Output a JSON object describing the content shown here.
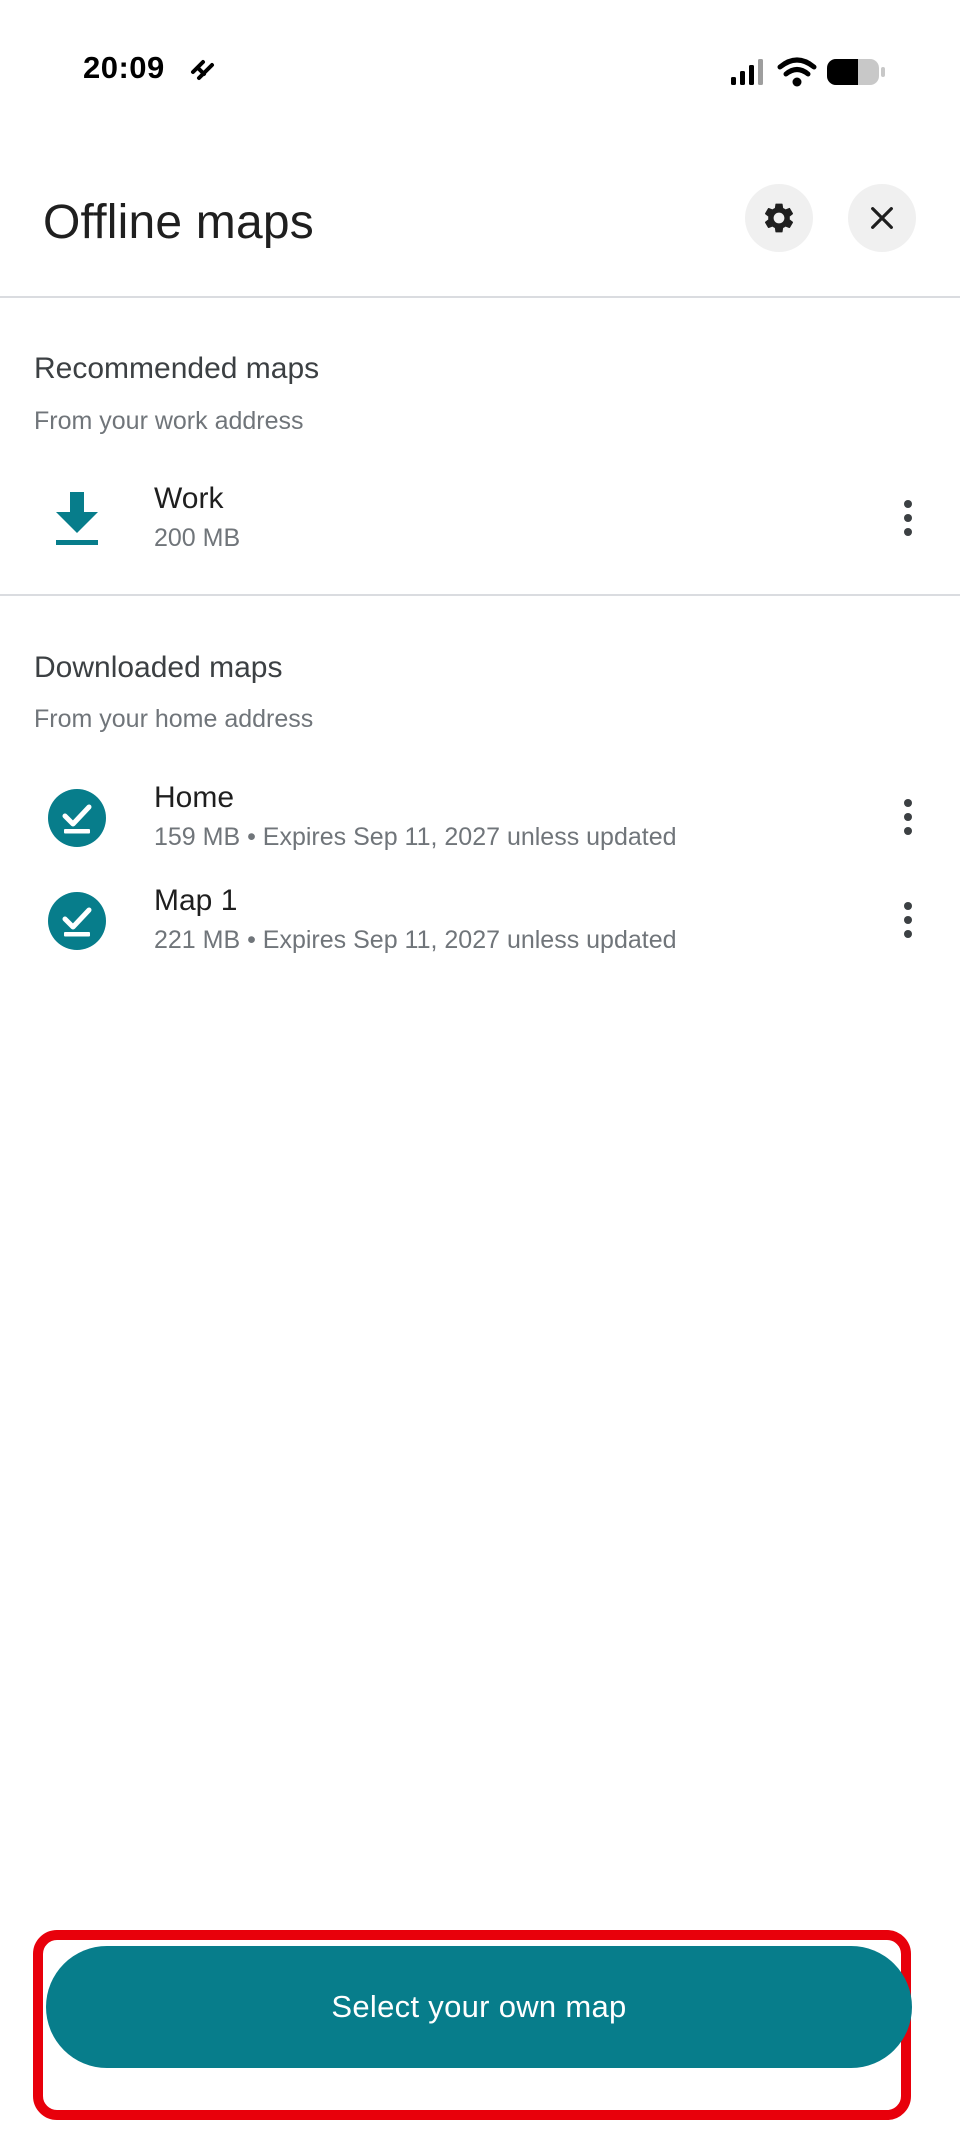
{
  "status_bar": {
    "time": "20:09",
    "icons": [
      "link-icon",
      "signal-icon",
      "wifi-icon",
      "battery-icon"
    ]
  },
  "header": {
    "title": "Offline maps",
    "settings_icon": "gear-icon",
    "close_icon": "close-icon"
  },
  "recommended": {
    "title": "Recommended maps",
    "subtitle": "From your work address",
    "items": [
      {
        "name": "Work",
        "detail": "200 MB",
        "icon": "download-icon"
      }
    ]
  },
  "downloaded": {
    "title": "Downloaded maps",
    "subtitle": "From your home address",
    "items": [
      {
        "name": "Home",
        "detail": "159 MB • Expires Sep 11, 2027 unless updated",
        "icon": "downloaded-check-icon"
      },
      {
        "name": "Map 1",
        "detail": "221 MB • Expires Sep 11, 2027 unless updated",
        "icon": "downloaded-check-icon"
      }
    ]
  },
  "actions": {
    "select_map_label": "Select your own map"
  },
  "colors": {
    "accent": "#077d8b",
    "highlight": "#e8000b",
    "divider": "#dadce0",
    "secondary_text": "#70757a"
  }
}
